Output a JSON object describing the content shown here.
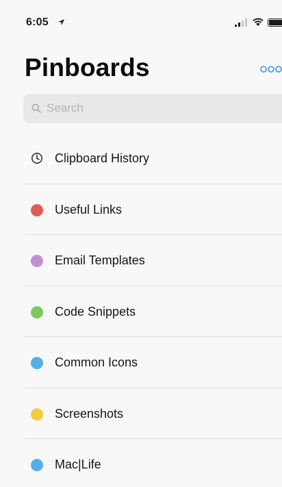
{
  "status_bar": {
    "time": "6:05"
  },
  "header": {
    "title": "Pinboards"
  },
  "search": {
    "placeholder": "Search",
    "value": ""
  },
  "pinboards": [
    {
      "label": "Clipboard History",
      "icon": "clock-icon",
      "color": "#333333"
    },
    {
      "label": "Useful Links",
      "icon": "dot",
      "color": "#e05a57"
    },
    {
      "label": "Email Templates",
      "icon": "dot",
      "color": "#c48fd0"
    },
    {
      "label": "Code Snippets",
      "icon": "dot",
      "color": "#7dc85a"
    },
    {
      "label": "Common Icons",
      "icon": "dot",
      "color": "#55aee8"
    },
    {
      "label": "Screenshots",
      "icon": "dot",
      "color": "#f2cc3c"
    },
    {
      "label": "Mac|Life",
      "icon": "dot",
      "color": "#55aee8"
    }
  ],
  "colors": {
    "accent": "#3c8ef2",
    "background": "#f8f8f8",
    "search_background": "#e8e8ea"
  }
}
